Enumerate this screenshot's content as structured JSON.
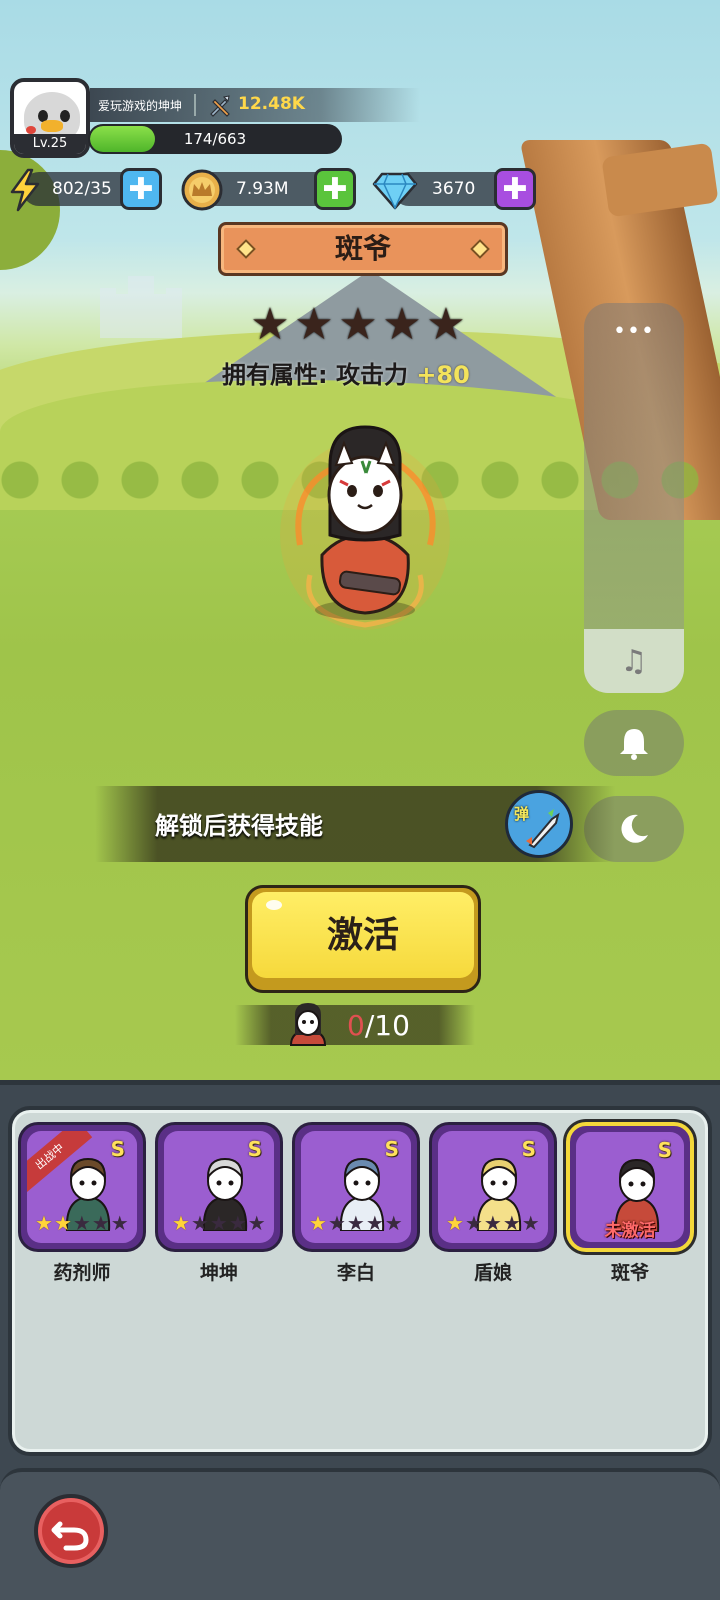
{
  "player": {
    "level": "Lv.25",
    "name": "爱玩游戏的坤坤",
    "power": "12.48K",
    "xp_text": "174/663",
    "xp_progress": 0.26
  },
  "resources": {
    "energy": "802/35",
    "gold": "7.93M",
    "gems": "3670"
  },
  "hero": {
    "name": "斑爷",
    "stars_total": 5,
    "stars_filled": 0,
    "attr_label": "拥有属性: 攻击力",
    "attr_bonus": "+80"
  },
  "skill": {
    "text": "解锁后获得技能",
    "icon_label": "弹"
  },
  "side_panel": {
    "more": "•••",
    "music_icon": "music-icon",
    "bell_icon": "bell-icon",
    "moon_icon": "moon-icon"
  },
  "activate": {
    "label": "激活",
    "shard_current": "0",
    "shard_total": "/10"
  },
  "roster": [
    {
      "name": "药剂师",
      "rank": "S",
      "stars": 2,
      "ribbon": "出战中",
      "status": ""
    },
    {
      "name": "坤坤",
      "rank": "S",
      "stars": 1,
      "ribbon": "",
      "status": ""
    },
    {
      "name": "李白",
      "rank": "S",
      "stars": 1,
      "ribbon": "",
      "status": ""
    },
    {
      "name": "盾娘",
      "rank": "S",
      "stars": 1,
      "ribbon": "",
      "status": ""
    },
    {
      "name": "斑爷",
      "rank": "S",
      "stars": 0,
      "ribbon": "",
      "status": "未激活"
    }
  ],
  "colors": {
    "card_purple": "#9b5ed0",
    "selected_border": "#f4d83a",
    "activate_yellow": "#f6d93c",
    "attr_bonus": "#f3e35b",
    "power_gold": "#ffd84a"
  }
}
